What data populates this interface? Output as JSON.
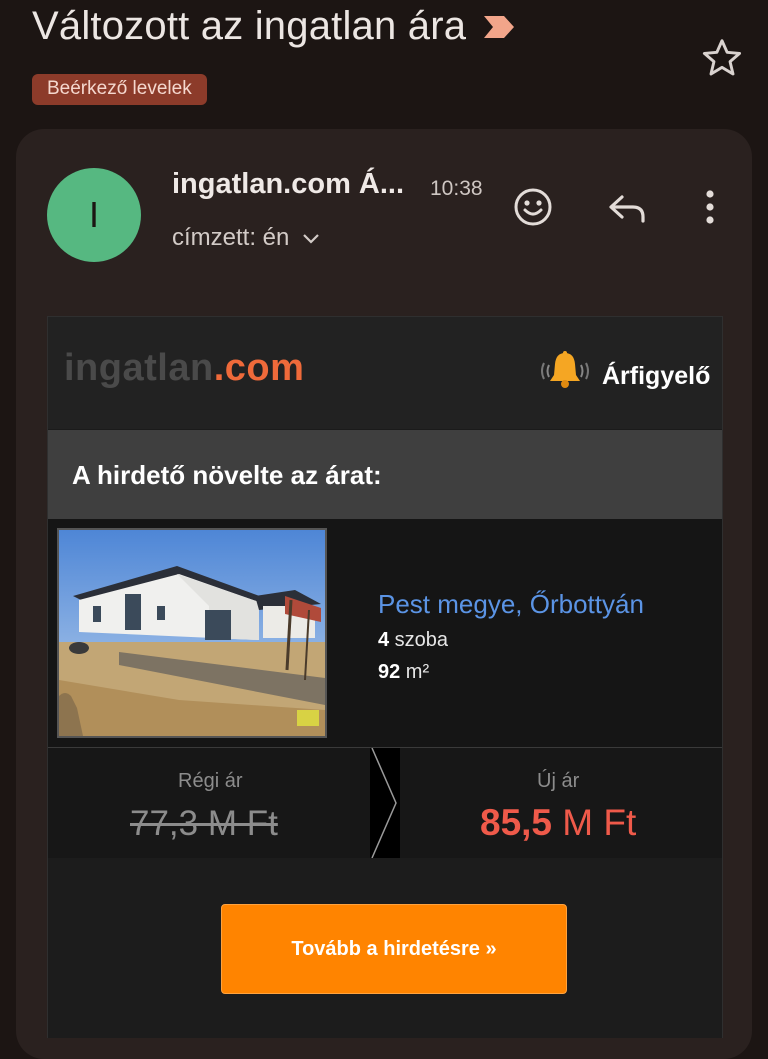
{
  "subject": {
    "title": "Változott az ingatlan ára",
    "importance_icon": "importance-marker-icon",
    "star_icon": "star-outline-icon"
  },
  "label_chip": "Beérkező levelek",
  "message": {
    "avatar_letter": "I",
    "avatar_color": "#56b881",
    "sender": "ingatlan.com Á...",
    "time": "10:38",
    "recipient": "címzett: én",
    "icons": [
      "smiley-icon",
      "reply-icon",
      "more-vert-icon"
    ]
  },
  "email": {
    "brand_part1": "ingatlan",
    "brand_part2": ".com",
    "brand_accent": "#ef6a3a",
    "watch_label": "Árfigyelő",
    "notice": "A hirdető növelte az árat:",
    "listing": {
      "location": "Pest megye, Őrbottyán",
      "rooms_value": "4",
      "rooms_unit": " szoba",
      "area_value": "92",
      "area_unit": " m²"
    },
    "prices": {
      "old_label": "Régi ár",
      "old_price": "77,3 M Ft",
      "new_label": "Új ár",
      "new_price_value": "85,5",
      "new_price_unit": " M Ft",
      "new_price_color": "#ef5a4a"
    },
    "cta_label": "Tovább a hirdetésre »",
    "cta_color": "#ff8400"
  }
}
